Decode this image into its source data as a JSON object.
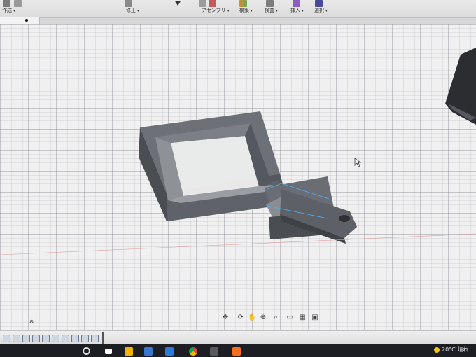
{
  "toolbar": {
    "create_label": "作成",
    "modify_label": "修正",
    "assemble_label": "アセンブリ",
    "construct_label": "構築",
    "inspect_label": "検査",
    "insert_label": "挿入",
    "select_label": "選択"
  },
  "colors": {
    "body_dark": "#4a4d52",
    "body_mid": "#6d7076",
    "body_light": "#8e9196",
    "grid_bg": "#f0f0f0",
    "selection_edge": "#49b6ff",
    "taskbar": "#1d1e24"
  },
  "icons": [
    "cursor-icon",
    "orbit-icon",
    "pan-icon",
    "zoom-icon",
    "display-settings-icon",
    "grid-settings-icon",
    "viewport-icon",
    "windows-start-icon",
    "search-icon",
    "file-explorer-icon",
    "chrome-icon",
    "fusion-icon",
    "weather-sun-icon"
  ],
  "status": {
    "weather_temp": "20°C",
    "weather_desc": "晴れ"
  }
}
